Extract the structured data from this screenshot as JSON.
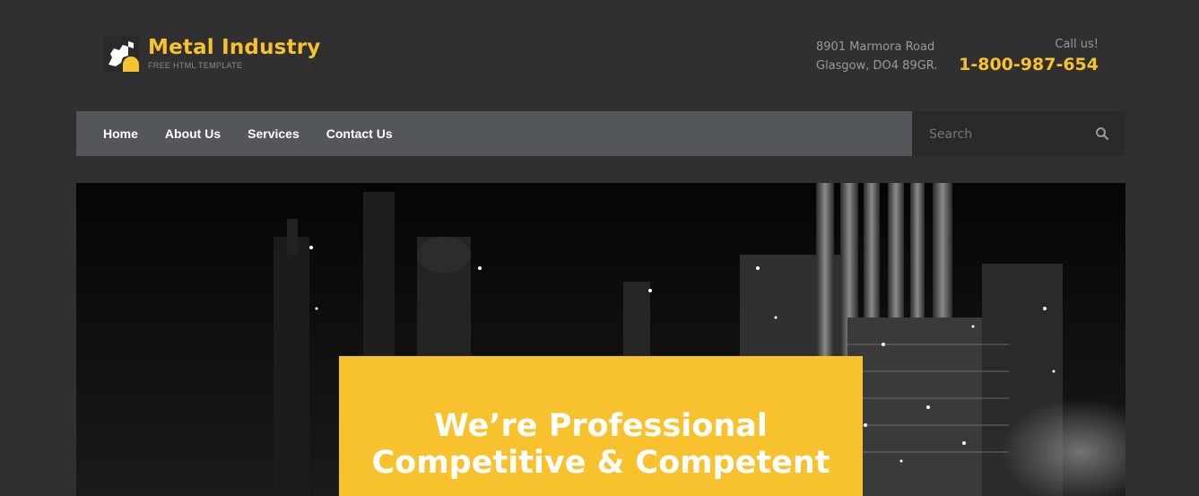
{
  "brand": {
    "title": "Metal Industry",
    "subtitle": "FREE HTML TEMPLATE",
    "accent": "#f8c22e"
  },
  "contact": {
    "address_line1": "8901 Marmora Road",
    "address_line2": "Glasgow, DO4 89GR.",
    "call_label": "Call us!",
    "phone": "1-800-987-654"
  },
  "nav": {
    "items": [
      {
        "label": "Home"
      },
      {
        "label": "About Us"
      },
      {
        "label": "Services"
      },
      {
        "label": "Contact Us"
      }
    ]
  },
  "search": {
    "placeholder": "Search",
    "icon": "search-icon"
  },
  "hero": {
    "headline_line1": "We’re Professional",
    "headline_line2": "Competitive & Competent"
  },
  "colors": {
    "background": "#303030",
    "nav_bg": "#53565b",
    "search_bg": "#2a2a2a"
  }
}
